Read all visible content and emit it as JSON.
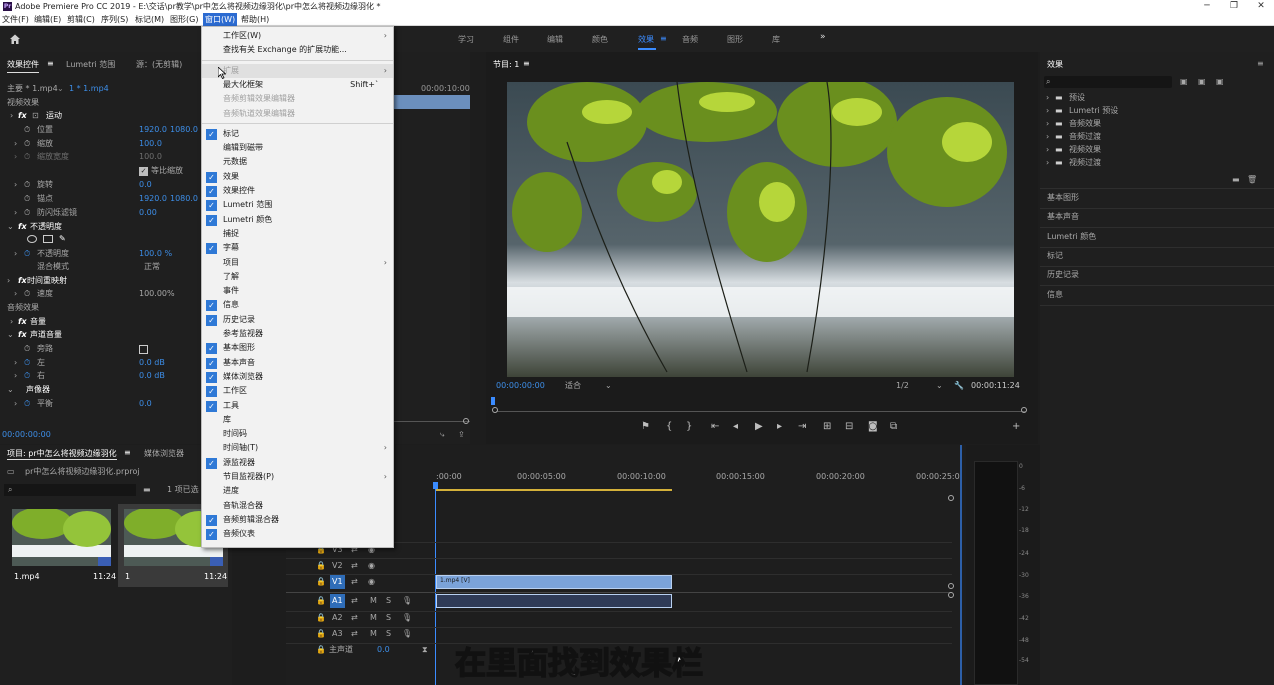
{
  "titlebar": {
    "app_title": "Adobe Premiere Pro CC 2019 - E:\\交话\\pr教学\\pr中怎么将视频边缘羽化\\pr中怎么将视频边缘羽化 *",
    "icon": "premiere-icon"
  },
  "menubar": {
    "items": [
      "文件(F)",
      "编辑(E)",
      "剪辑(C)",
      "序列(S)",
      "标记(M)",
      "图形(G)",
      "窗口(W)",
      "帮助(H)"
    ],
    "active_index": 6
  },
  "workspaces": {
    "items": [
      "学习",
      "组件",
      "编辑",
      "颜色",
      "效果",
      "音频",
      "图形",
      "库"
    ],
    "active": "效果",
    "more": "»"
  },
  "effect_controls": {
    "tabs": [
      "效果控件",
      "Lumetri 范围",
      "源：(无剪辑)"
    ],
    "clip_header": {
      "master": "主要 * 1.mp4",
      "clip": "1 * 1.mp4",
      "ruler_time": "00:00:10:00"
    },
    "video_effects_label": "视频效果",
    "motion": {
      "label": "运动",
      "position_label": "位置",
      "position_x": "1920.0",
      "position_y": "1080.0",
      "scale_label": "缩放",
      "scale": "100.0",
      "scale_width_label": "缩放宽度",
      "scale_width": "100.0",
      "uniform_label": "等比缩放",
      "rotation_label": "旋转",
      "rotation": "0.0",
      "anchor_label": "锚点",
      "anchor_x": "1920.0",
      "anchor_y": "1080.0",
      "flicker_label": "防闪烁滤镜",
      "flicker": "0.00"
    },
    "opacity": {
      "label": "不透明度",
      "opacity_label": "不透明度",
      "opacity": "100.0 %",
      "blend_label": "混合模式",
      "blend": "正常"
    },
    "time_remap": {
      "label": "时间重映射",
      "speed_label": "速度",
      "speed": "100.00%"
    },
    "audio_effects_label": "音频效果",
    "volume": {
      "label": "音量",
      "channel_label": "声道音量",
      "bypass_label": "旁路",
      "left_label": "左",
      "left": "0.0 dB",
      "right_label": "右",
      "right": "0.0 dB"
    },
    "panner": {
      "label": "声像器",
      "balance_label": "平衡",
      "balance": "0.0"
    },
    "timecode": "00:00:00:00"
  },
  "window_menu": {
    "items": [
      {
        "label": "工作区(W)",
        "submenu": true,
        "checked": false,
        "disabled": false
      },
      {
        "label": "查找有关 Exchange 的扩展功能...",
        "submenu": false,
        "checked": false,
        "disabled": false
      },
      {
        "sep": true
      },
      {
        "label": "扩展",
        "submenu": true,
        "checked": false,
        "disabled": true,
        "hover": true
      },
      {
        "label": "最大化框架",
        "shortcut": "Shift+`",
        "submenu": false,
        "checked": false,
        "disabled": false
      },
      {
        "label": "音频剪辑效果编辑器",
        "submenu": false,
        "checked": false,
        "disabled": true
      },
      {
        "label": "音频轨道效果编辑器",
        "submenu": false,
        "checked": false,
        "disabled": true
      },
      {
        "sep": true
      },
      {
        "label": "标记",
        "checked": true
      },
      {
        "label": "编辑到磁带",
        "checked": false
      },
      {
        "label": "元数据",
        "checked": false
      },
      {
        "label": "效果",
        "checked": true
      },
      {
        "label": "效果控件",
        "checked": true
      },
      {
        "label": "Lumetri 范围",
        "checked": true
      },
      {
        "label": "Lumetri 颜色",
        "checked": true
      },
      {
        "label": "捕捉",
        "checked": false
      },
      {
        "label": "字幕",
        "checked": true
      },
      {
        "label": "项目",
        "checked": false,
        "submenu": true
      },
      {
        "label": "了解",
        "checked": false
      },
      {
        "label": "事件",
        "checked": false
      },
      {
        "label": "信息",
        "checked": true
      },
      {
        "label": "历史记录",
        "checked": true
      },
      {
        "label": "参考监视器",
        "checked": false
      },
      {
        "label": "基本图形",
        "checked": true
      },
      {
        "label": "基本声音",
        "checked": true
      },
      {
        "label": "媒体浏览器",
        "checked": true
      },
      {
        "label": "工作区",
        "checked": true
      },
      {
        "label": "工具",
        "checked": true
      },
      {
        "label": "库",
        "checked": false
      },
      {
        "label": "时间码",
        "checked": false
      },
      {
        "label": "时间轴(T)",
        "checked": false,
        "submenu": true
      },
      {
        "label": "源监视器",
        "checked": true
      },
      {
        "label": "节目监视器(P)",
        "checked": false,
        "submenu": true
      },
      {
        "label": "进度",
        "checked": false
      },
      {
        "label": "音轨混合器",
        "checked": false
      },
      {
        "label": "音频剪辑混合器",
        "checked": true
      },
      {
        "label": "音频仪表",
        "checked": true
      }
    ]
  },
  "program_monitor": {
    "title": "节目: 1",
    "timecode": "00:00:00:00",
    "fit": "适合",
    "resolution": "1/2",
    "duration": "00:00:11:24"
  },
  "effects_panel": {
    "title": "效果",
    "folders": [
      "预设",
      "Lumetri 预设",
      "音频效果",
      "音频过渡",
      "视频效果",
      "视频过渡"
    ],
    "collapsed_panels": [
      "基本图形",
      "基本声音",
      "Lumetri 颜色",
      "标记",
      "历史记录",
      "信息"
    ]
  },
  "project_panel": {
    "tabs": [
      "项目: pr中怎么将视频边缘羽化",
      "媒体浏览器"
    ],
    "file": "pr中怎么将视频边缘羽化.prproj",
    "selected_info": "1 项已选",
    "items": [
      {
        "name": "1.mp4",
        "duration": "11:24"
      },
      {
        "name": "1",
        "duration": "11:24"
      }
    ]
  },
  "timeline": {
    "ruler": [
      ":00:00",
      "00:00:05:00",
      "00:00:10:00",
      "00:00:15:00",
      "00:00:20:00",
      "00:00:25:0"
    ],
    "tracks": [
      "V3",
      "V2",
      "V1",
      "A1",
      "A2",
      "A3"
    ],
    "master_label": "主声道",
    "master_value": "0.0",
    "clip_label": "1.mp4 [V]",
    "meter_ticks": [
      "0",
      "-6",
      "-12",
      "-18",
      "-24",
      "-30",
      "-36",
      "-42",
      "-48",
      "-54"
    ]
  },
  "subtitle": "在里面找到效果栏"
}
